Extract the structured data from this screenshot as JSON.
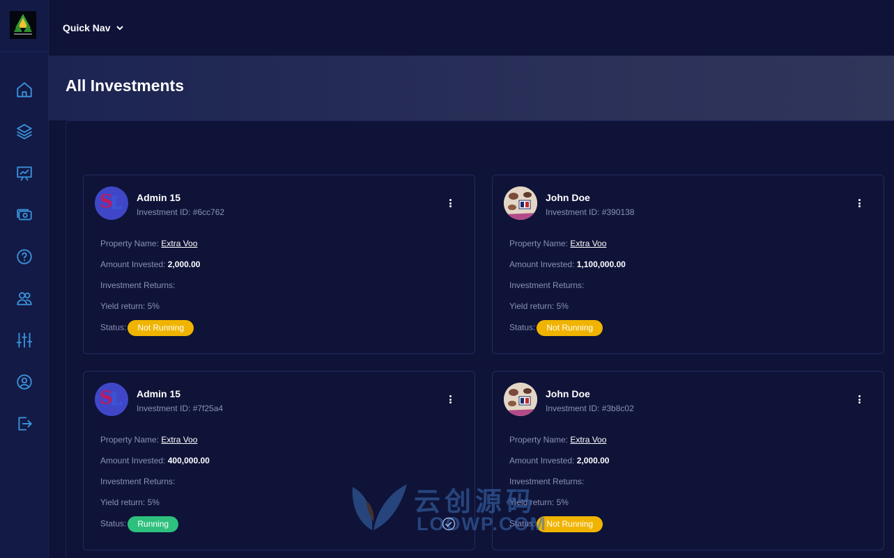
{
  "topbar": {
    "quick_nav_label": "Quick Nav"
  },
  "sidebar": {
    "items": [
      {
        "icon": "home-icon"
      },
      {
        "icon": "layers-icon"
      },
      {
        "icon": "presentation-chart-icon"
      },
      {
        "icon": "money-icon"
      },
      {
        "icon": "help-icon"
      },
      {
        "icon": "users-icon"
      },
      {
        "icon": "sliders-icon"
      },
      {
        "icon": "user-circle-icon"
      },
      {
        "icon": "logout-icon"
      }
    ]
  },
  "page": {
    "title": "All Investments"
  },
  "labels": {
    "property_name": "Property Name:",
    "amount_invested": "Amount Invested:",
    "investment_returns": "Investment Returns:",
    "status": "Status:"
  },
  "investments": [
    {
      "name": "Admin 15",
      "id": "Investment ID: #6cc762",
      "property": "Extra Voo",
      "amount": "2,000.00",
      "yield": "Yield return: 5%",
      "status": "Not Running"
    },
    {
      "name": "John Doe",
      "id": "Investment ID: #390138",
      "property": "Extra Voo",
      "amount": "1,100,000.00",
      "yield": "Yield return: 5%",
      "status": "Not Running"
    },
    {
      "name": "Admin 15",
      "id": "Investment ID: #7f25a4",
      "property": "Extra Voo",
      "amount": "400,000.00",
      "yield": "Yield return: 5%",
      "status": "Running"
    },
    {
      "name": "John Doe",
      "id": "Investment ID: #3b8c02",
      "property": "Extra Voo",
      "amount": "2,000.00",
      "yield": "Yield return: 5%",
      "status": "Not Running"
    }
  ],
  "colors": {
    "warning": "#f0b400",
    "success": "#2ec07d",
    "accent": "#3a8fd8"
  },
  "watermark": {
    "line1": "云创源码",
    "line2": "LOOWP.COM"
  }
}
